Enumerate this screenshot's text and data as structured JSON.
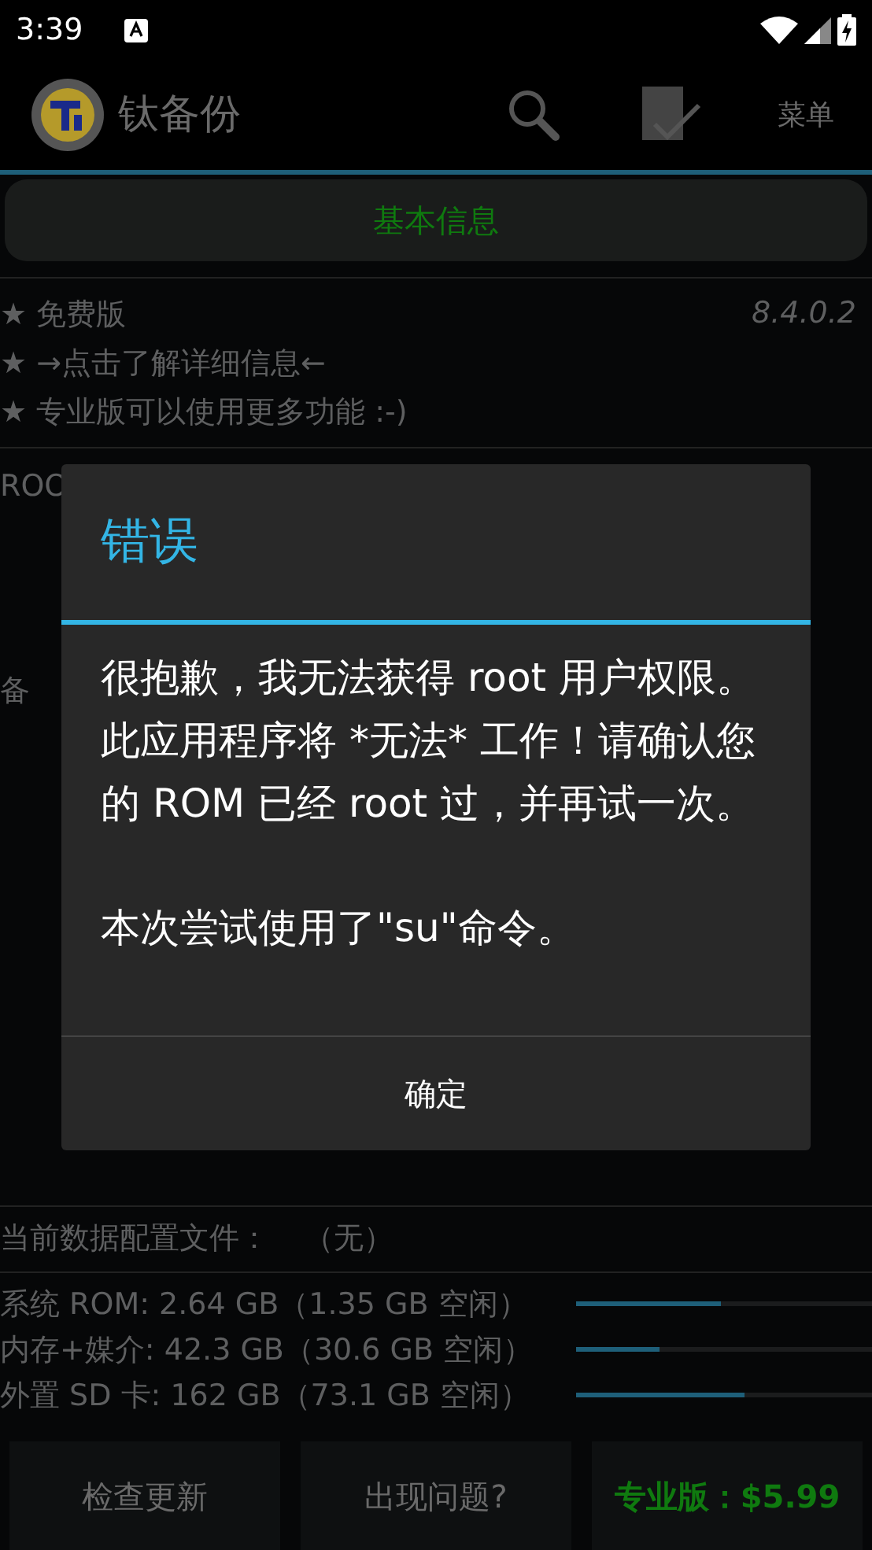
{
  "status_bar": {
    "time": "3:39"
  },
  "app_bar": {
    "title": "钛备份",
    "menu": "菜单"
  },
  "tab": {
    "label": "基本信息",
    "selected": true
  },
  "info": {
    "lines": [
      "★ 免费版",
      "★  →点击了解详细信息←",
      "★ 专业版可以使用更多功能 :-)"
    ],
    "version": "8.4.0.2"
  },
  "background_texts": [
    "ROO",
    "备"
  ],
  "dialog": {
    "title": "错误",
    "message": "很抱歉，我无法获得 root 用户权限。此应用程序将 *无法* 工作！请确认您的 ROM 已经 root 过，并再试一次。",
    "note": "本次尝试使用了\"su\"命令。",
    "button": "确定"
  },
  "profile": {
    "label": "当前数据配置文件：",
    "value": "（无）"
  },
  "storage": [
    {
      "label": "系统 ROM:  2.64 GB（1.35 GB 空闲）",
      "level": 0.49
    },
    {
      "label": "内存+媒介:  42.3 GB（30.6 GB 空闲）",
      "level": 0.28
    },
    {
      "label": "外置 SD 卡: 162 GB（73.1 GB 空闲）",
      "level": 0.57
    }
  ],
  "buttons": [
    {
      "label": "检查更新",
      "kind": "plain"
    },
    {
      "label": "出现问题?",
      "kind": "plain"
    },
    {
      "label": "专业版：$5.99",
      "kind": "pro"
    }
  ]
}
